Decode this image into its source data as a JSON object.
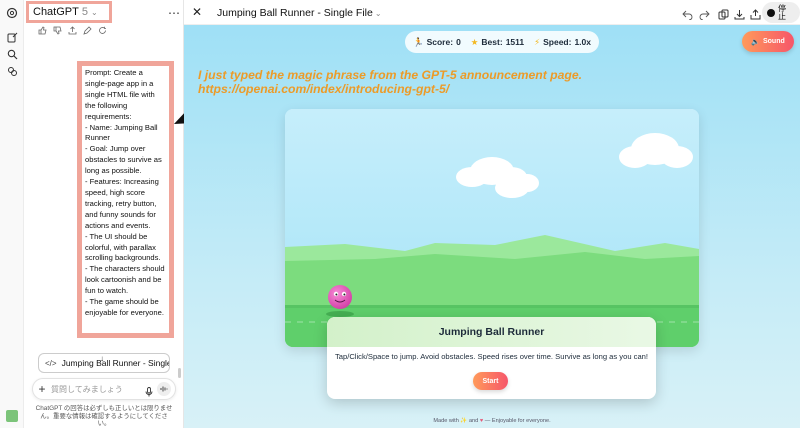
{
  "app": {
    "chat_title": "ChatGPT",
    "chat_version": "5",
    "chat_version_chevron": "⌄",
    "more_menu": "⋯"
  },
  "prompt": {
    "text": "Prompt: Create a single-page app in a single HTML file with the following requirements:\n- Name: Jumping Ball Runner\n- Goal: Jump over obstacles to survive as long as possible.\n- Features: Increasing speed, high score tracking, retry button, and funny sounds for actions and events.\n- The UI should be colorful, with parallax scrolling backgrounds.\n- The characters should look cartoonish and be fun to watch.\n- The game should be enjoyable for everyone."
  },
  "attachment": {
    "icon": "code-icon",
    "label": "Jumping Ball Runner - Single File"
  },
  "composer": {
    "placeholder": "質問してみましょう",
    "plus": "+"
  },
  "disclaimer": "ChatGPT の回答は必ずしも正しいとは限りません。重要な情報は確認するようにしてください。",
  "canvas": {
    "close": "✕",
    "title": "Jumping Ball Runner - Single File",
    "title_chevron": "⌄",
    "stop_label": "停止"
  },
  "game": {
    "score_label": "Score:",
    "score_value": "0",
    "best_label": "Best:",
    "best_value": "1511",
    "speed_label": "Speed:",
    "speed_value": "1.0x",
    "sound_label": "Sound",
    "dialog_title": "Jumping Ball Runner",
    "dialog_text": "Tap/Click/Space to jump. Avoid obstacles. Speed rises over time. Survive as long as you can!",
    "start_label": "Start",
    "footer_prefix": "Made with",
    "footer_suffix": "— Enjoyable for everyone."
  },
  "annotation": {
    "line1": "I just typed the magic phrase from the GPT-5 announcement page.",
    "line2": "https://openai.com/index/introducing-gpt-5/"
  },
  "colors": {
    "highlight_border": "#f0a59a",
    "annotation": "#ec9b28",
    "button_gradient_start": "#ff9a5a",
    "button_gradient_end": "#f6566a",
    "ball": "#e04fb3",
    "ground": "#5fd06f",
    "sky": "#a9e6f8"
  }
}
